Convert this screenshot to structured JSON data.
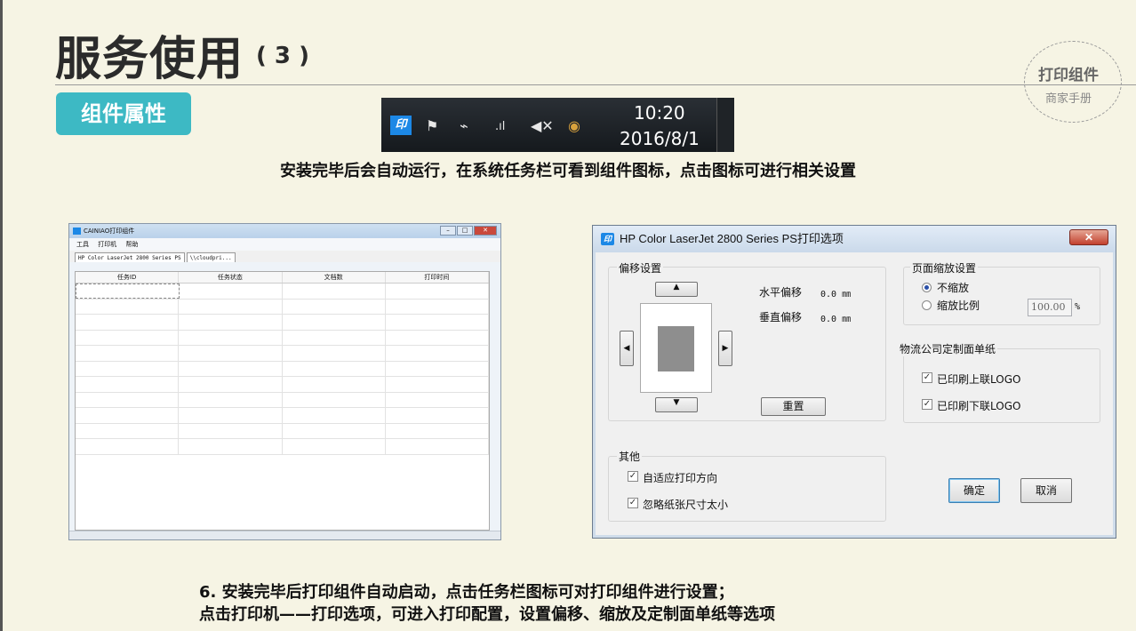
{
  "header": {
    "title": "服务使用",
    "title_suffix": "( 3 )",
    "section_badge": "组件属性",
    "seal_title": "打印组件",
    "seal_subtitle": "商家手册"
  },
  "taskbar": {
    "app_icon_text": "印",
    "time": "10:20",
    "date": "2016/8/1"
  },
  "captions": {
    "top": "安装完毕后会自动运行，在系统任务栏可看到组件图标，点击图标可进行相关设置",
    "bottom_line1": "6. 安装完毕后打印组件自动启动，点击任务栏图标可对打印组件进行设置；",
    "bottom_line2": "点击打印机——打印选项，可进入打印配置，设置偏移、缩放及定制面单纸等选项"
  },
  "component_window": {
    "title": "CAINIAO打印组件",
    "menu": [
      "工具",
      "打印机",
      "帮助"
    ],
    "tabs": [
      "HP Color LaserJet 2800 Series PS",
      "\\\\cloudpri..."
    ],
    "columns": [
      "任务ID",
      "任务状态",
      "文档数",
      "打印时间"
    ],
    "row_count": 11
  },
  "print_dialog": {
    "title": "HP Color LaserJet 2800 Series PS打印选项",
    "icon_text": "印",
    "offset_group": "偏移设置",
    "h_offset_label": "水平偏移",
    "h_offset_value": "0.0 ㎜",
    "v_offset_label": "垂直偏移",
    "v_offset_value": "0.0 ㎜",
    "reset_button": "重置",
    "scale_group": "页面缩放设置",
    "no_scale": "不缩放",
    "scale_ratio": "缩放比例",
    "scale_value": "100.00",
    "scale_unit": "%",
    "logistics_group": "物流公司定制面单纸",
    "print_top_logo": "已印刷上联LOGO",
    "print_bottom_logo": "已印刷下联LOGO",
    "other_group": "其他",
    "auto_orientation": "自适应打印方向",
    "ignore_small_paper": "忽略纸张尺寸太小",
    "ok_button": "确定",
    "cancel_button": "取消"
  },
  "colors": {
    "background": "#f6f4e4",
    "badge": "#3db9c4",
    "app_icon": "#1c88e6"
  }
}
